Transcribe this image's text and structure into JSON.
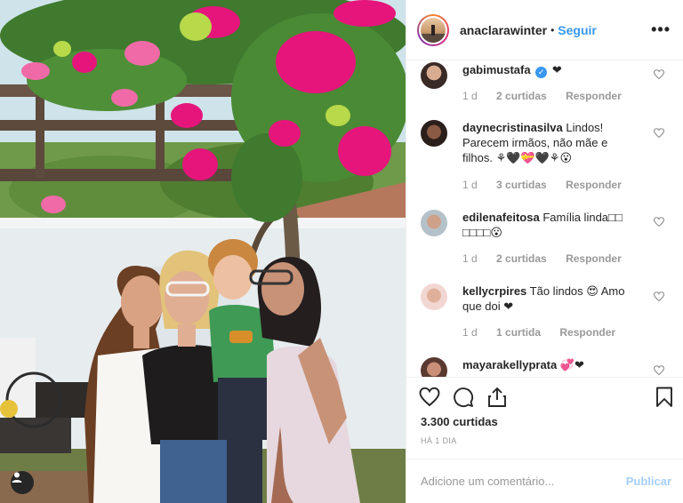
{
  "post": {
    "username": "anaclarawinter",
    "separator": "•",
    "follow_label": "Seguir",
    "more_label": "•••",
    "likes_total": "3.300 curtidas",
    "time_ago": "HÁ 1 DIA",
    "photo_alt_icon": "user-tag-icon"
  },
  "comments": [
    {
      "user": "gabimustafa",
      "verified": true,
      "verified_mark": "✓",
      "text": "❤",
      "age": "1 d",
      "likes": "2 curtidas",
      "reply": "Responder"
    },
    {
      "user": "daynecristinasilva",
      "verified": false,
      "text": "Lindos! Parecem irmãos, não mãe e filhos. ⚘🖤💝🖤⚘😮",
      "age": "1 d",
      "likes": "3 curtidas",
      "reply": "Responder"
    },
    {
      "user": "edilenafeitosa",
      "verified": false,
      "text": "Família linda□□ □□□□😮",
      "age": "1 d",
      "likes": "2 curtidas",
      "reply": "Responder"
    },
    {
      "user": "kellycrpires",
      "verified": false,
      "text": "Tão lindos 😍 Amo que doi ❤",
      "age": "1 d",
      "likes": "1 curtida",
      "reply": "Responder"
    },
    {
      "user": "mayarakellyprata",
      "verified": false,
      "text": "💞❤",
      "age": "",
      "likes": "",
      "reply": ""
    }
  ],
  "composer": {
    "placeholder": "Adicione um comentário...",
    "publish_label": "Publicar"
  },
  "colors": {
    "link_blue": "#3897f0",
    "text": "#262626",
    "muted": "#999999",
    "border": "#efefef"
  }
}
